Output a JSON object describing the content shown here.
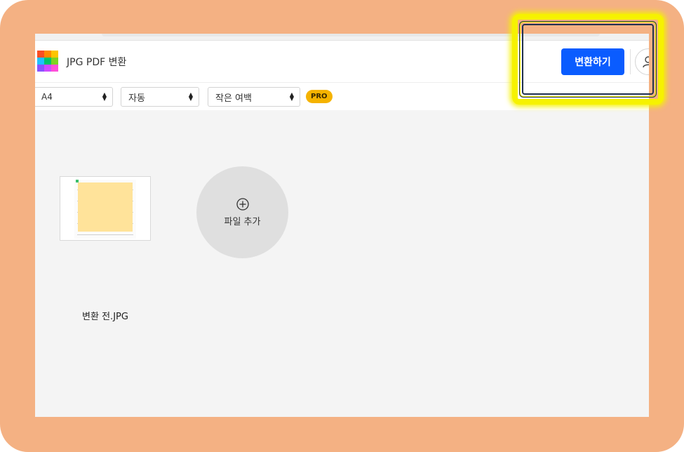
{
  "header": {
    "title": "JPG PDF 변환",
    "convert_button": "변환하기",
    "logo_colors": [
      "#f94e24",
      "#ff8a00",
      "#ffc400",
      "#1ec0ff",
      "#00c46a",
      "#7ed321",
      "#8a52ff",
      "#d04bff",
      "#ff4fd8"
    ]
  },
  "toolbar": {
    "page_size": "A4",
    "orientation": "자동",
    "margin": "작은 여백",
    "pro_badge": "PRO"
  },
  "files": [
    {
      "name": "변환 전.JPG"
    }
  ],
  "add_file": {
    "label": "파일 추가"
  },
  "colors": {
    "accent": "#0a5cff",
    "frame": "#f4b183",
    "highlight": "#f6f200",
    "pro": "#f5b300"
  }
}
